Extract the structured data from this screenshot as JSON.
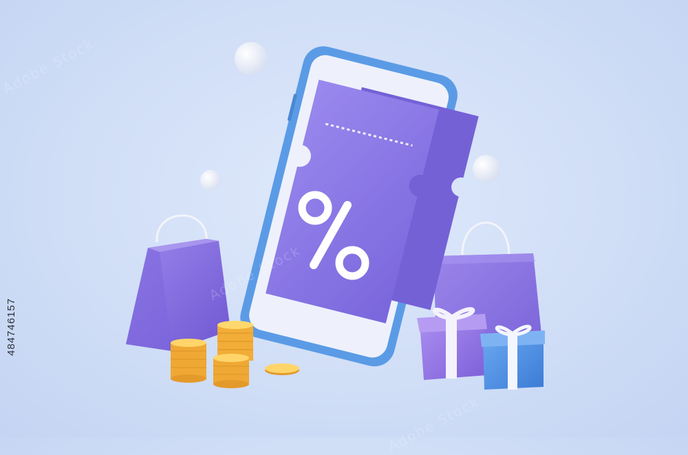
{
  "image": {
    "stock_id": "484746157",
    "watermark_text": "Adobe Stock",
    "coupon_symbol": "%",
    "colors": {
      "background": "#d3e0f7",
      "phone_frame": "#5b9be6",
      "phone_screen": "#eef1fb",
      "ticket": "#8b78e6",
      "ticket_dark": "#7560d8",
      "bag": "#8a74e0",
      "gift_purple": "#9a7be6",
      "gift_blue": "#4f8fe0",
      "ribbon": "#ffffff",
      "coin": "#f6c24a"
    }
  }
}
